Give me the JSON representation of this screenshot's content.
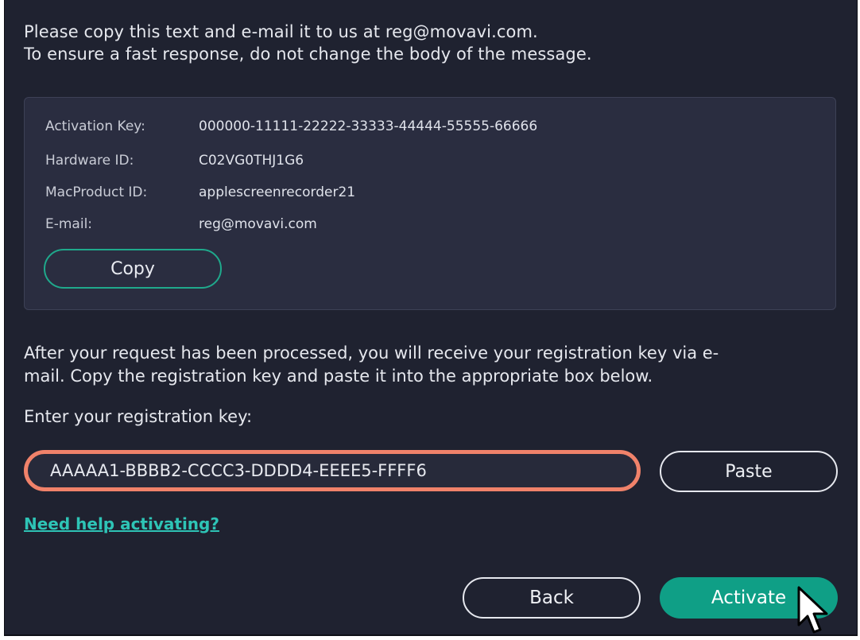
{
  "intro": {
    "line1": "Please copy this text and e-mail it to us at reg@movavi.com.",
    "line2": "To ensure a fast response, do not change the body of the message."
  },
  "info": {
    "rows": [
      {
        "label": "Activation Key:",
        "value": "000000-11111-22222-33333-44444-55555-66666"
      },
      {
        "label": "Hardware ID:",
        "value": "C02VG0THJ1G6"
      },
      {
        "label": "MacProduct ID:",
        "value": "applescreenrecorder21"
      },
      {
        "label": "E-mail:",
        "value": "reg@movavi.com"
      }
    ],
    "copy_label": "Copy"
  },
  "after": {
    "line1": "After your request has been processed, you will receive your registration key via e-",
    "line2": "mail. Copy the registration key and paste it into the appropriate box below."
  },
  "registration": {
    "label": "Enter your registration key:",
    "value": "AAAAA1-BBBB2-CCCC3-DDDD4-EEEE5-FFFF6",
    "paste_label": "Paste"
  },
  "help_link": "Need help activating?",
  "footer": {
    "back_label": "Back",
    "activate_label": "Activate"
  },
  "colors": {
    "background": "#1f2230",
    "panel": "#2a2d40",
    "accent": "#0f9f86",
    "focus_ring": "#f0826a",
    "link": "#2ec4b6"
  }
}
